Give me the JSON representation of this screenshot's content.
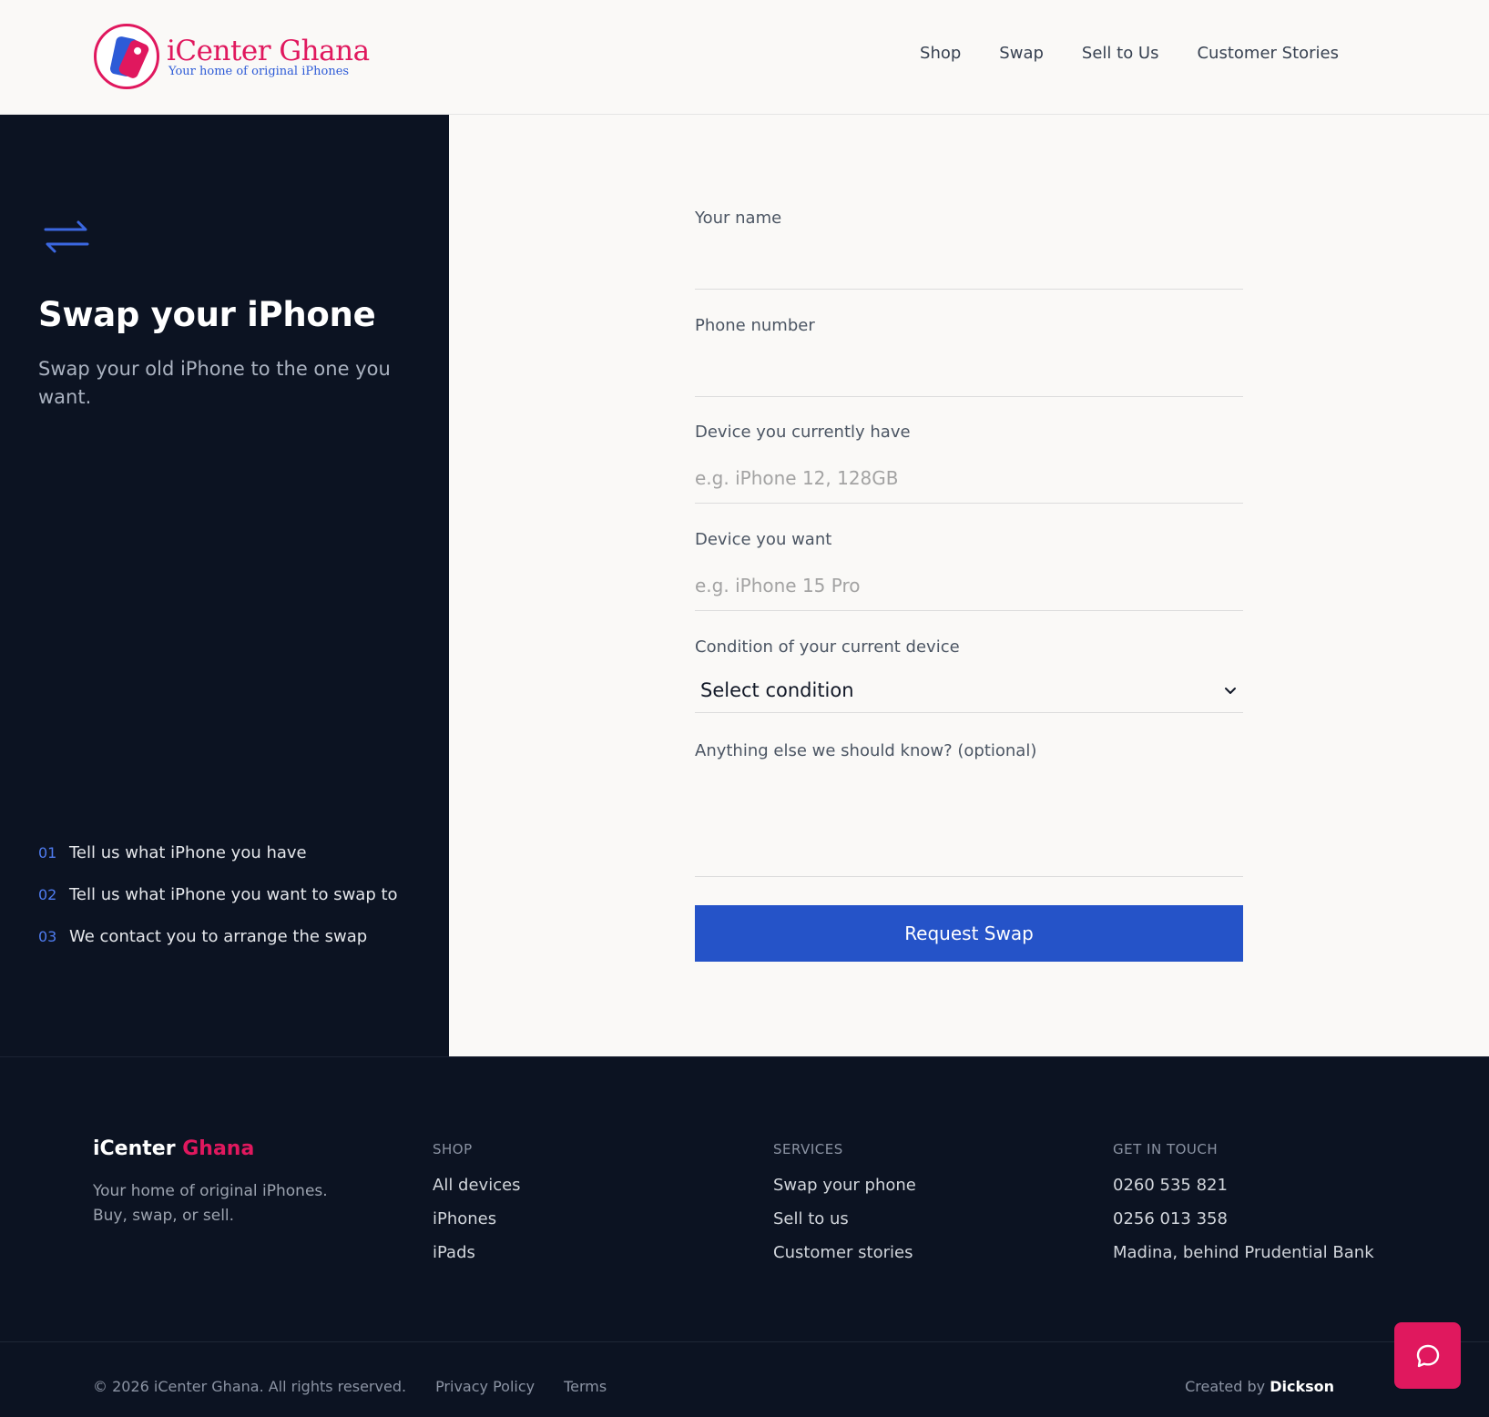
{
  "header": {
    "logo_title": "iCenter Ghana",
    "logo_tagline": "Your home of original iPhones",
    "nav": [
      "Shop",
      "Swap",
      "Sell to Us",
      "Customer Stories"
    ]
  },
  "left_panel": {
    "icon": "swap-arrows-icon",
    "title": "Swap your iPhone",
    "subtitle": "Swap your old iPhone to the one you want.",
    "steps": [
      {
        "num": "01",
        "text": "Tell us what iPhone you have"
      },
      {
        "num": "02",
        "text": "Tell us what iPhone you want to swap to"
      },
      {
        "num": "03",
        "text": "We contact you to arrange the swap"
      }
    ]
  },
  "form": {
    "name_label": "Your name",
    "name_value": "",
    "phone_label": "Phone number",
    "phone_value": "",
    "current_device_label": "Device you currently have",
    "current_device_placeholder": "e.g. iPhone 12, 128GB",
    "wanted_device_label": "Device you want",
    "wanted_device_placeholder": "e.g. iPhone 15 Pro",
    "condition_label": "Condition of your current device",
    "condition_value": "Select condition",
    "notes_label": "Anything else we should know? (optional)",
    "submit_label": "Request Swap"
  },
  "footer": {
    "brand_main": "iCenter",
    "brand_accent": "Ghana",
    "description": "Your home of original iPhones. Buy, swap, or sell.",
    "shop": {
      "title": "SHOP",
      "links": [
        "All devices",
        "iPhones",
        "iPads"
      ]
    },
    "services": {
      "title": "SERVICES",
      "links": [
        "Swap your phone",
        "Sell to us",
        "Customer stories"
      ]
    },
    "contact": {
      "title": "GET IN TOUCH",
      "items": [
        "0260 535 821",
        "0256 013 358",
        "Madina, behind Prudential Bank"
      ]
    },
    "copyright": "© 2026 iCenter Ghana. All rights reserved.",
    "privacy": "Privacy Policy",
    "terms": "Terms",
    "credit_prefix": "Created by",
    "credit_name": "Dickson"
  },
  "colors": {
    "brand_pink": "#e0185e",
    "brand_blue": "#2553c8",
    "dark_panel": "#0c1322"
  }
}
